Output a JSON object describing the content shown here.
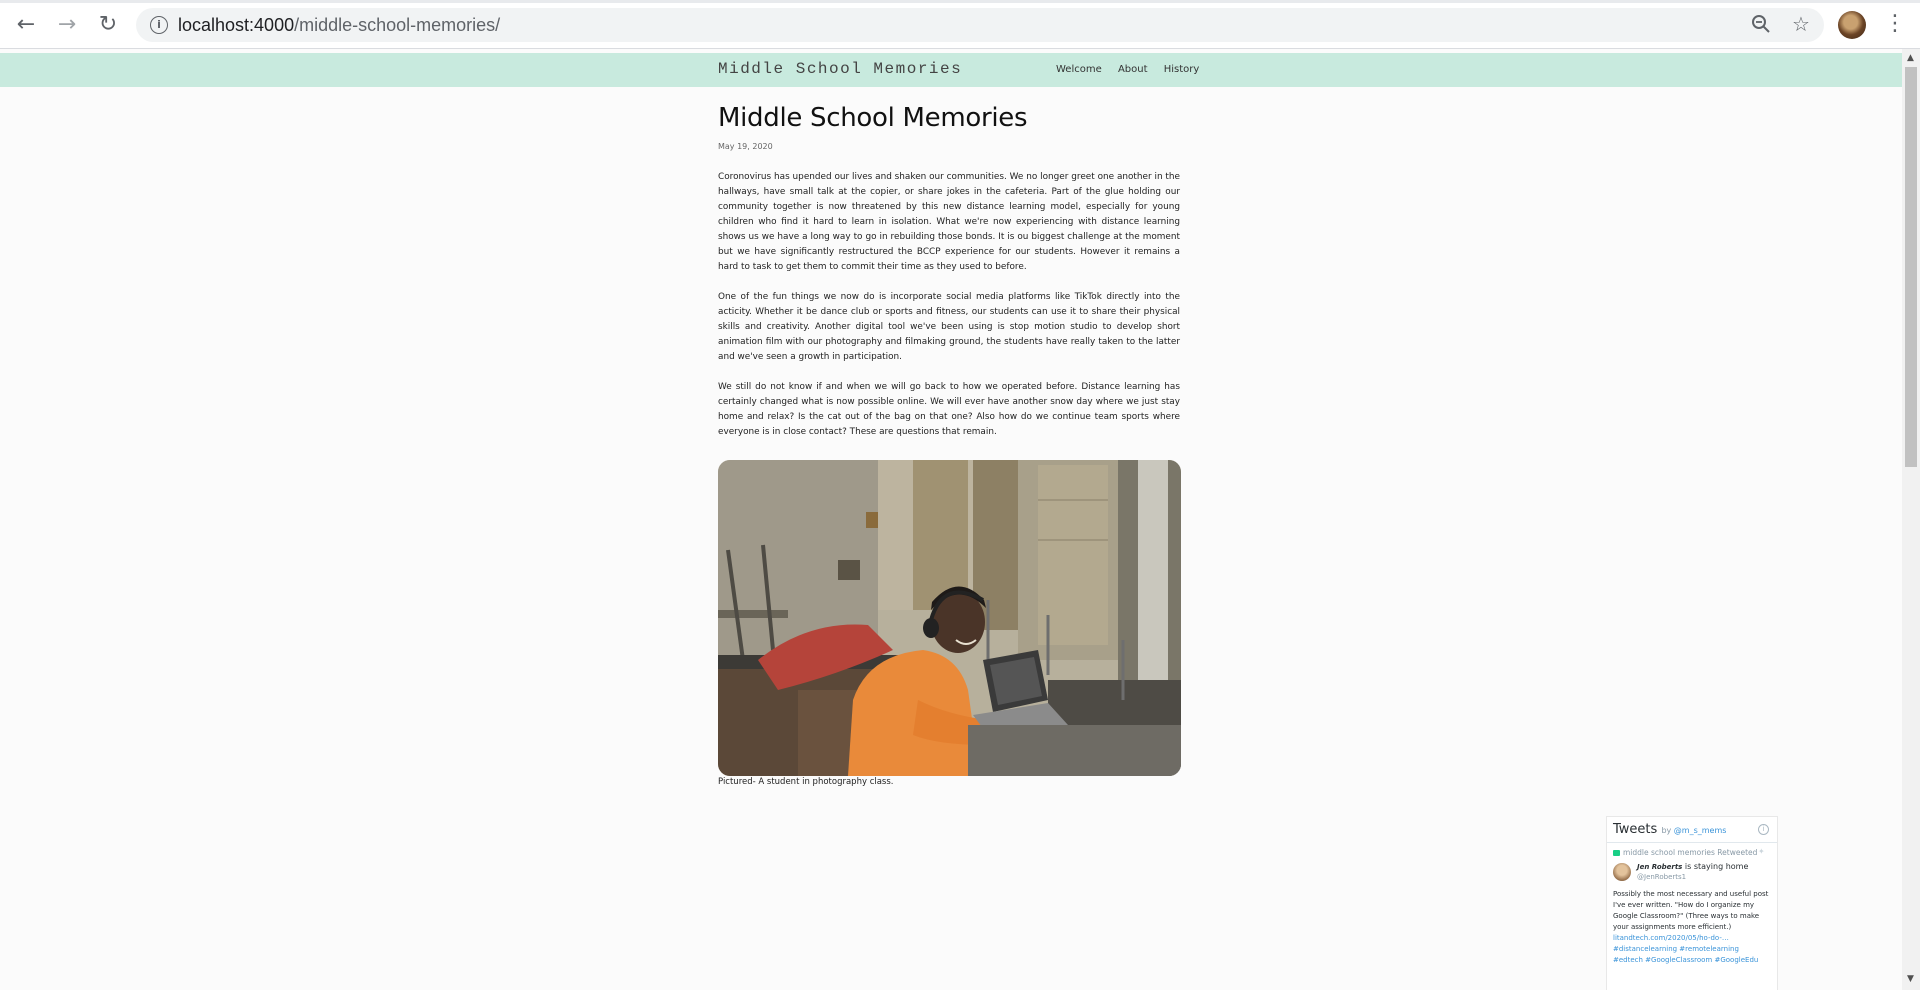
{
  "browser": {
    "url_host": "localhost:4000",
    "url_path": "/middle-school-memories/",
    "back_icon": "arrow-left-icon",
    "forward_icon": "arrow-right-icon",
    "reload_icon": "reload-icon",
    "info_icon": "info-icon",
    "zoom_icon": "zoom-out-icon",
    "star_icon": "star-icon",
    "menu_icon": "menu-dots-icon"
  },
  "site": {
    "title": "Middle School Memories",
    "nav": [
      "Welcome",
      "About",
      "History"
    ],
    "header_color": "#c8eade"
  },
  "post": {
    "title": "Middle School Memories",
    "date": "May 19, 2020",
    "paragraphs": [
      "Coronovirus has upended our lives and shaken our communities. We no longer greet one another in the hallways, have small talk at the copier, or share jokes in the cafeteria. Part of the glue holding our community together is now threatened by this new distance learning model, especially for young children who find it hard to learn in isolation. What we're now experiencing with distance learning shows us we have a long way to go in rebuilding those bonds. It is ou biggest challenge at the moment but we have significantly restructured the BCCP experience for our students. However it remains a hard to task to get them to commit their time as they used to before.",
      "One of the fun things we now do is incorporate social media platforms like TikTok directly into the acticity. Whether it be dance club or sports and fitness, our students can use it to share their physical skills and creativity. Another digital tool we've been using is stop motion studio to develop short animation film with our photography and filmaking ground, the students have really taken to the latter and we've seen a growth in participation.",
      "We still do not know if and when we will go back to how we operated before. Distance learning has certainly changed what is now possible online. We will ever have another snow day where we just stay home and relax? Is the cat out of the bag on that one? Also how do we continue team sports where everyone is in close contact? These are questions that remain."
    ],
    "caption": "Pictured- A student in photography class."
  },
  "tweets": {
    "title": "Tweets",
    "by": "by",
    "handle": "@m_s_mems",
    "retweet_line": "middle school memories Retweeted",
    "author_name": "Jen Roberts",
    "author_status": " is staying home",
    "author_handle": "@JenRoberts1",
    "text": "Possibly the most necessary and useful post I've ever written. \"How do I organize my Google Classroom?\" (Three ways to make your assignments more efficient.)",
    "link": "litandtech.com/2020/05/ho-do-…",
    "hashtags": "#distancelearning #remotelearning #edtech #GoogleClassroom #GoogleEdu"
  }
}
